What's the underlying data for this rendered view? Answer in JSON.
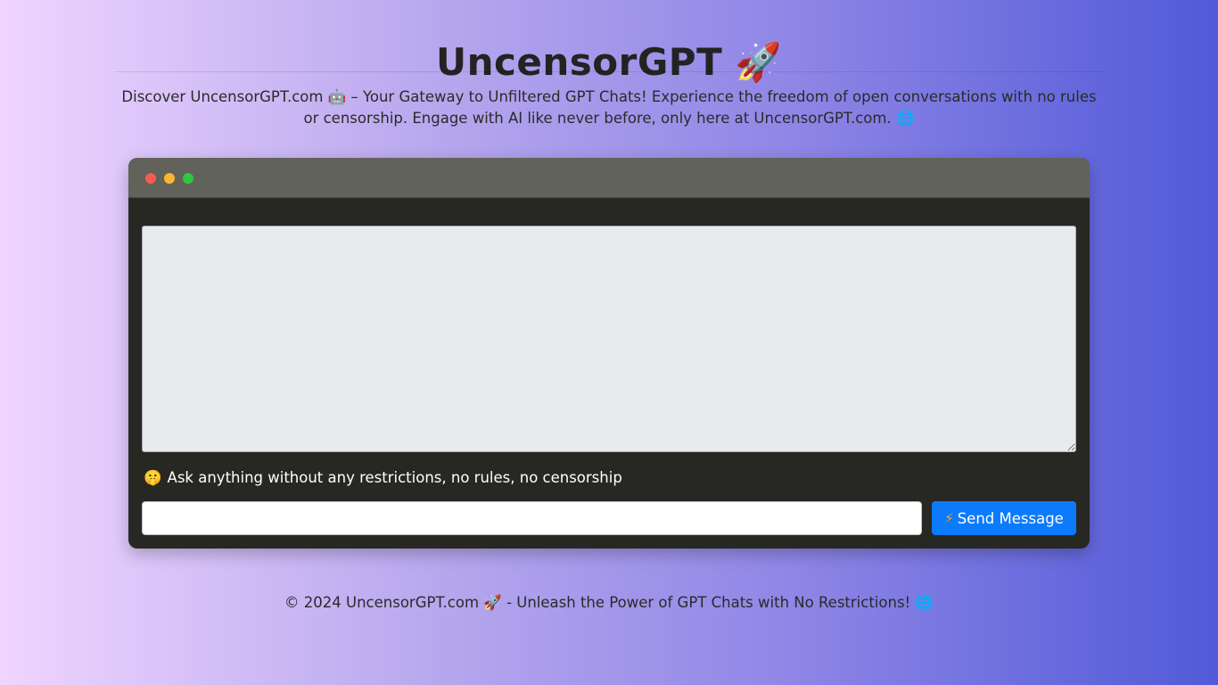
{
  "header": {
    "title": "UncensorGPT",
    "title_emoji": "🚀"
  },
  "intro": {
    "text": "Discover UncensorGPT.com 🤖 – Your Gateway to Unfiltered GPT Chats! Experience the freedom of open conversations with no rules or censorship. Engage with AI like never before, only here at UncensorGPT.com. 🌐"
  },
  "chat": {
    "transcript_value": "",
    "hint_emoji": "🤫",
    "hint_text": "Ask anything without any restrictions, no rules, no censorship",
    "input_value": "",
    "send_icon": "⚡",
    "send_label": "Send Message"
  },
  "footer": {
    "text": "© 2024 UncensorGPT.com 🚀 - Unleash the Power of GPT Chats with No Restrictions! 🌐"
  },
  "colors": {
    "window_bg": "#272723",
    "window_bar": "#61625a",
    "send_button": "#0b7bfb",
    "dot_red": "#fb5a52",
    "dot_yellow": "#fdb52e",
    "dot_green": "#2fc840"
  },
  "icons": {
    "window_controls": [
      "close-dot",
      "minimize-dot",
      "maximize-dot"
    ],
    "send": "lightning-icon"
  }
}
